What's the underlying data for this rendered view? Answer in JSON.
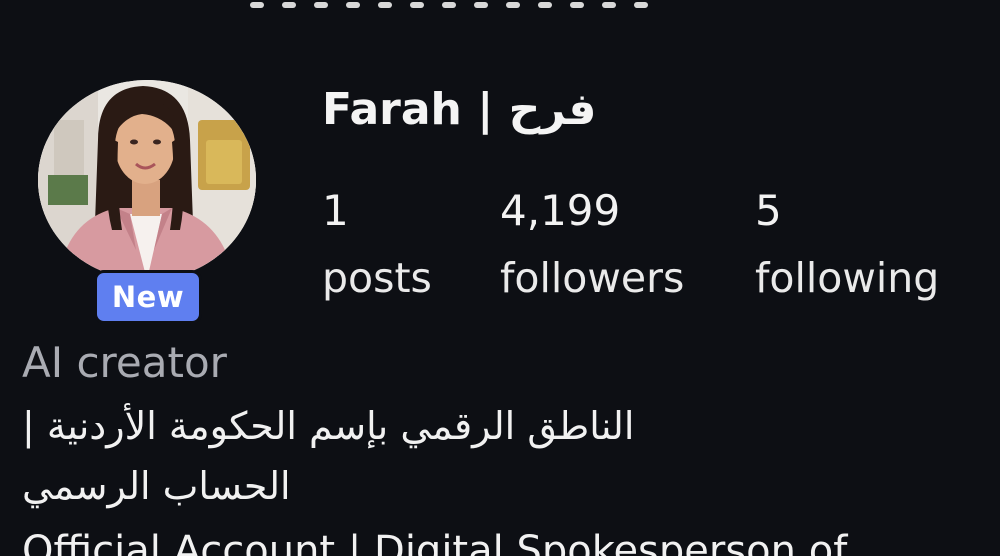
{
  "profile": {
    "name": "Farah | فرح",
    "badge": "New",
    "category": "AI creator",
    "avatar_icon": "profile-photo",
    "badge_color": "#5f7ff0"
  },
  "stats": {
    "posts": {
      "value": "1",
      "label": "posts"
    },
    "followers": {
      "value": "4,199",
      "label": "followers"
    },
    "following": {
      "value": "5",
      "label": "following"
    }
  },
  "bio": {
    "line1": "الناطق الرقمي بإسم الحكومة الأردنية |",
    "line2": "الحساب الرسمي",
    "line3": "Official Account | Digital Spokesperson of"
  },
  "colors": {
    "background": "#0d0f14",
    "text": "#f2f2f2",
    "muted": "#a9abb2"
  }
}
